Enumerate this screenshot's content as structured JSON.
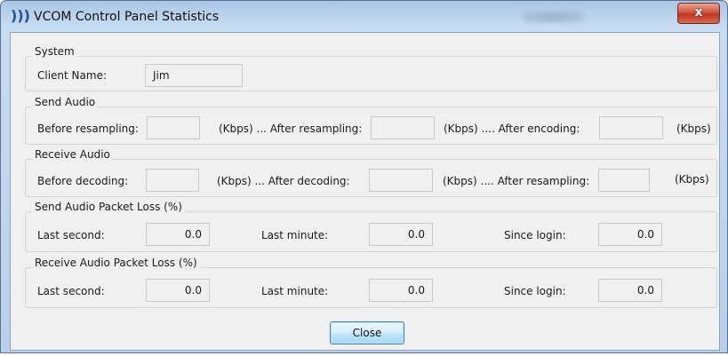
{
  "window": {
    "title": "VCOM Control Panel Statistics",
    "close_glyph": "x",
    "app_icon": "vcom-speaker-icon"
  },
  "system": {
    "title": "System",
    "client_name_label": "Client Name:",
    "client_name_value": "Jim"
  },
  "send_audio": {
    "title": "Send Audio",
    "before_label": "Before resampling:",
    "before_value": "",
    "kbps_after_label": "(Kbps) ... After resampling:",
    "after_value": "",
    "kbps_after2_label": "(Kbps) .... After encoding:",
    "encoding_value": "",
    "kbps_label": "(Kbps)"
  },
  "receive_audio": {
    "title": "Receive Audio",
    "before_label": "Before decoding:",
    "before_value": "",
    "kbps_after_label": "(Kbps) ... After decoding:",
    "after_value": "",
    "kbps_after2_label": "(Kbps) .... After resampling:",
    "resampling_value": "",
    "kbps_label": "(Kbps)"
  },
  "send_loss": {
    "title": "Send Audio Packet Loss (%)",
    "last_second_label": "Last second:",
    "last_second_value": "0.0",
    "last_minute_label": "Last minute:",
    "last_minute_value": "0.0",
    "since_login_label": "Since login:",
    "since_login_value": "0.0"
  },
  "receive_loss": {
    "title": "Receive Audio Packet Loss (%)",
    "last_second_label": "Last second:",
    "last_second_value": "0.0",
    "last_minute_label": "Last minute:",
    "last_minute_value": "0.0",
    "since_login_label": "Since login:",
    "since_login_value": "0.0"
  },
  "buttons": {
    "close_label": "Close"
  },
  "colors": {
    "titlebar": "#b9d0ea",
    "close_button": "#c1361f",
    "dialog_bg": "#f0f0f0",
    "ok_button": "#bee6fd"
  }
}
